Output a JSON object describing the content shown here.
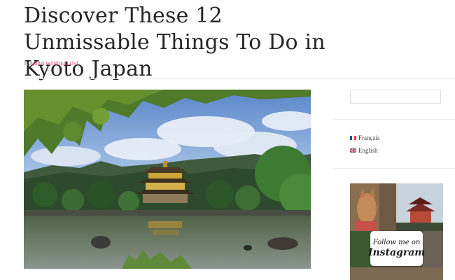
{
  "post": {
    "title": "Discover These 12 Unmissable Things To Do in Kyoto Japan",
    "by_prefix": "by",
    "author": "ASIAN WANDERLUST",
    "image_alt": "Kinkaku-ji Golden Pavilion reflected in the pond"
  },
  "sidebar": {
    "search": {
      "value": "",
      "placeholder": ""
    },
    "languages": [
      {
        "label": "Français",
        "flag": "france-flag-icon"
      },
      {
        "label": "English",
        "flag": "uk-flag-icon"
      }
    ],
    "instagram": {
      "line1": "Follow me on",
      "line2": "Instagram"
    }
  },
  "colors": {
    "accent": "#e0306e",
    "text": "#262626",
    "divider": "#ececec"
  }
}
